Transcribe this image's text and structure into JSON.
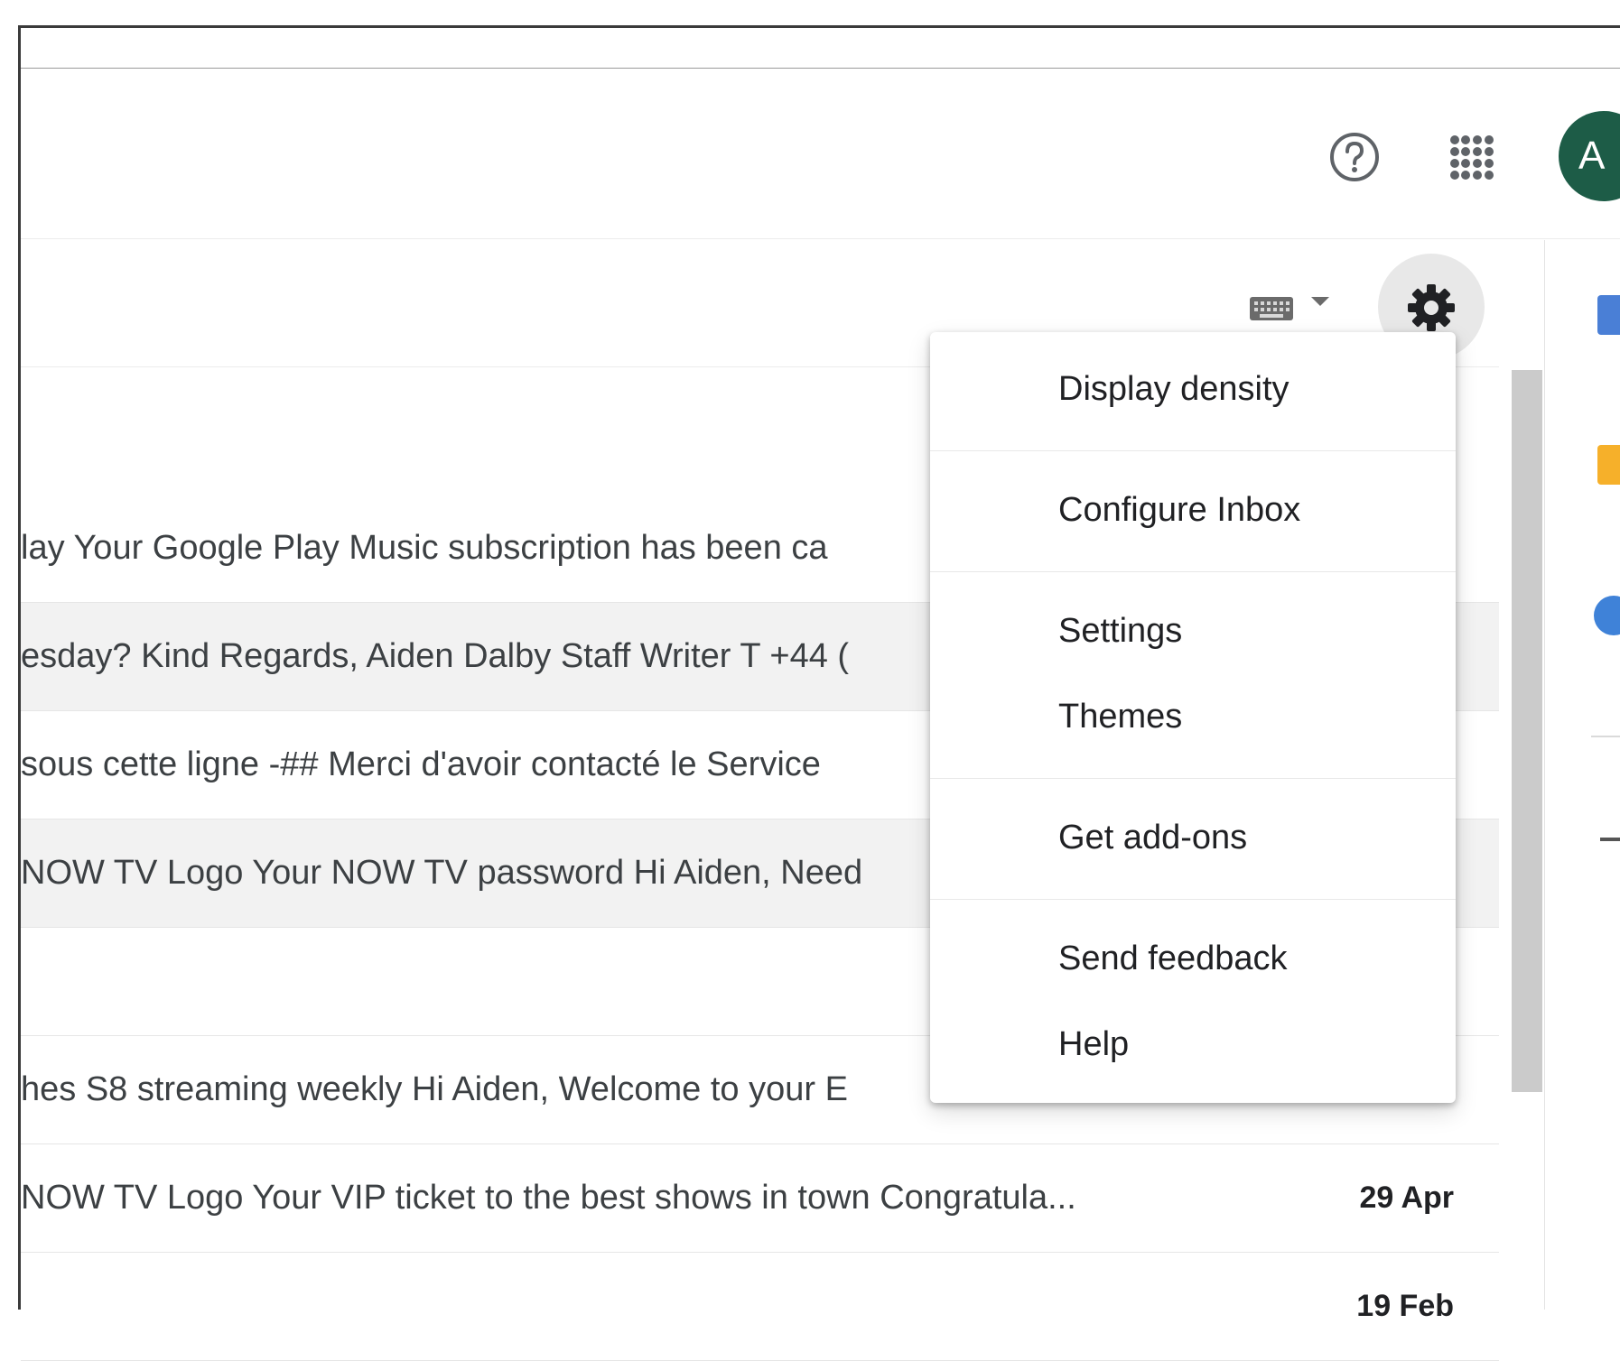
{
  "header": {
    "avatar_letter": "A",
    "icons": [
      "help-icon",
      "apps-grid-icon"
    ]
  },
  "toolbar": {
    "icons": [
      "keyboard-icon",
      "chevron-down-icon",
      "gear-icon"
    ]
  },
  "settings_menu": {
    "items": [
      {
        "label": "Display density"
      },
      {
        "label": "Configure Inbox"
      },
      {
        "label": "Settings"
      },
      {
        "label": "Themes"
      },
      {
        "label": "Get add-ons"
      },
      {
        "label": "Send feedback"
      },
      {
        "label": "Help"
      }
    ]
  },
  "messages": [
    {
      "snippet": "",
      "date": ""
    },
    {
      "snippet": "lay Your Google Play Music subscription has been ca",
      "date": ""
    },
    {
      "snippet": "esday? Kind Regards, Aiden Dalby Staff Writer T +44 (",
      "date": ""
    },
    {
      "snippet": " sous cette ligne -## Merci d'avoir contacté le Service",
      "date": ""
    },
    {
      "snippet": "NOW TV Logo Your NOW TV password Hi Aiden, Need",
      "date": ""
    },
    {
      "snippet": "",
      "date": ""
    },
    {
      "snippet": "hes S8 streaming weekly Hi Aiden, Welcome to your E",
      "date": ""
    },
    {
      "snippet": "NOW TV Logo Your VIP ticket to the best shows in town Congratula...",
      "date": "29 Apr"
    },
    {
      "snippet": "",
      "date": "19 Feb"
    }
  ],
  "colors": {
    "avatar_bg": "#1d5c47",
    "gear_button_bg": "#e8e8e8",
    "shaded_row_bg": "#f2f2f2",
    "calendar_accent": "#4a7fd6",
    "keep_accent": "#f6b02a",
    "tasks_accent": "#3f82d8"
  }
}
